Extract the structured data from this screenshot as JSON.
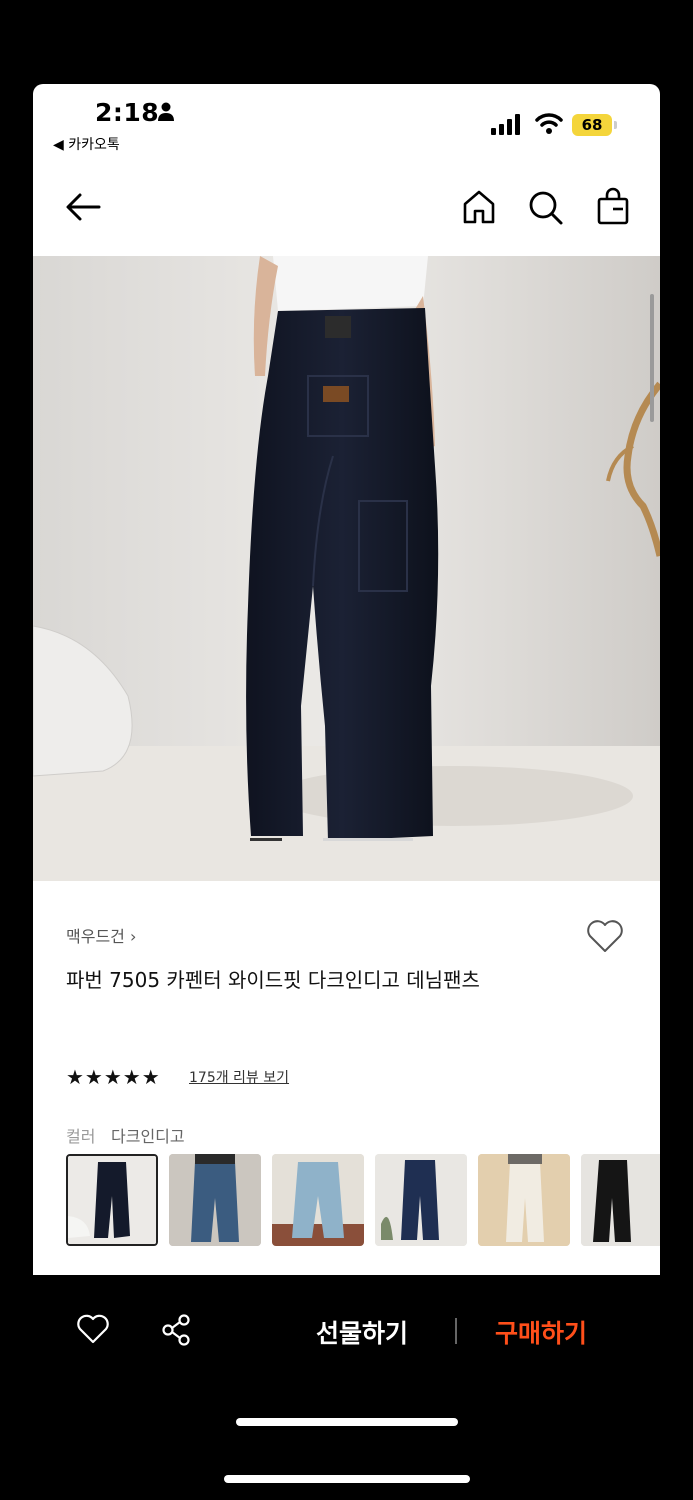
{
  "status_bar": {
    "time": "2:18",
    "back_app": "◀ 카카오톡",
    "battery": "68"
  },
  "nav": {
    "icons": [
      "back-arrow-icon",
      "home-icon",
      "search-icon",
      "shopping-bag-icon"
    ]
  },
  "product": {
    "brand": "맥우드건 ›",
    "title": "파번 7505 카펜터 와이드핏 다크인디고 데님팬츠",
    "stars": "★★★★★",
    "review_link": "175개 리뷰 보기",
    "color_label": "컬러",
    "color_value": "다크인디고",
    "thumbnails": [
      "다크인디고",
      "미드블루",
      "라이트블루",
      "인디고",
      "베이지",
      "블랙"
    ]
  },
  "bottom_bar": {
    "gift": "선물하기",
    "buy": "구매하기",
    "buy_color": "#ff4f1a"
  }
}
